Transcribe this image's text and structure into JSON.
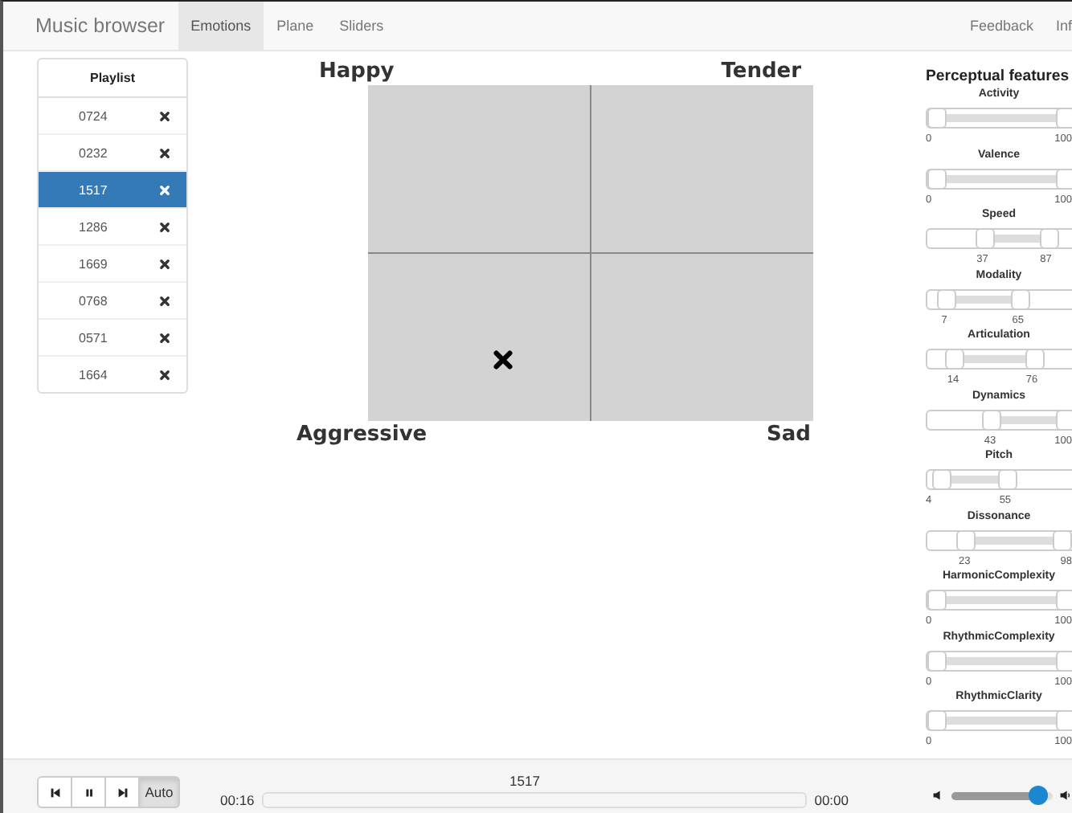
{
  "navbar": {
    "brand": "Music browser",
    "tabs": [
      {
        "label": "Emotions",
        "selected": true
      },
      {
        "label": "Plane",
        "selected": false
      },
      {
        "label": "Sliders",
        "selected": false
      }
    ],
    "links": [
      "Feedback",
      "Inf"
    ]
  },
  "playlist": {
    "title": "Playlist",
    "items": [
      {
        "label": "0724",
        "selected": false
      },
      {
        "label": "0232",
        "selected": false
      },
      {
        "label": "1517",
        "selected": true
      },
      {
        "label": "1286",
        "selected": false
      },
      {
        "label": "1669",
        "selected": false
      },
      {
        "label": "0768",
        "selected": false
      },
      {
        "label": "0571",
        "selected": false
      },
      {
        "label": "1664",
        "selected": false
      }
    ]
  },
  "emotion_plane": {
    "labels": [
      "Happy",
      "Tender",
      "Aggressive",
      "Sad"
    ]
  },
  "features": {
    "title": "Perceptual features",
    "sliders": [
      {
        "name": "Activity",
        "handles": [
          {
            "label": "0",
            "level": 0
          },
          {
            "label": "100",
            "level": 1
          }
        ]
      },
      {
        "name": "Valence",
        "handles": [
          {
            "label": "0",
            "level": 0
          },
          {
            "label": "100",
            "level": 1
          }
        ]
      },
      {
        "name": "Speed",
        "handles": [
          {
            "label": "37",
            "level": 0.37
          },
          {
            "label": "87",
            "level": 0.87
          }
        ]
      },
      {
        "name": "Modality",
        "handles": [
          {
            "label": "7",
            "level": 0.07
          },
          {
            "label": "65",
            "level": 0.65
          }
        ]
      },
      {
        "name": "Articulation",
        "handles": [
          {
            "label": "14",
            "level": 0.14
          },
          {
            "label": "76",
            "level": 0.76
          }
        ]
      },
      {
        "name": "Dynamics",
        "handles": [
          {
            "label": "43",
            "level": 0.43
          },
          {
            "label": "100",
            "level": 1
          }
        ]
      },
      {
        "name": "Pitch",
        "handles": [
          {
            "label": "4",
            "level": 0.04
          },
          {
            "label": "55",
            "level": 0.55
          }
        ]
      },
      {
        "name": "Dissonance",
        "handles": [
          {
            "label": "23",
            "level": 0.23
          },
          {
            "label": "98",
            "level": 0.98
          }
        ]
      },
      {
        "name": "HarmonicComplexity",
        "handles": [
          {
            "label": "0",
            "level": 0
          },
          {
            "label": "100",
            "level": 1
          }
        ]
      },
      {
        "name": "RhythmicComplexity",
        "handles": [
          {
            "label": "0",
            "level": 0
          },
          {
            "label": "100",
            "level": 1
          }
        ]
      },
      {
        "name": "RhythmicClarity",
        "handles": [
          {
            "label": "0",
            "level": 0
          },
          {
            "label": "100",
            "level": 1
          }
        ]
      }
    ]
  },
  "player": {
    "track": "1517",
    "auto_button": {
      "label": "Auto",
      "active": true
    },
    "elapsed": "00:16",
    "remaining": "00:00",
    "progress": {
      "level": 0
    },
    "volume": {
      "level": 0.95
    }
  }
}
